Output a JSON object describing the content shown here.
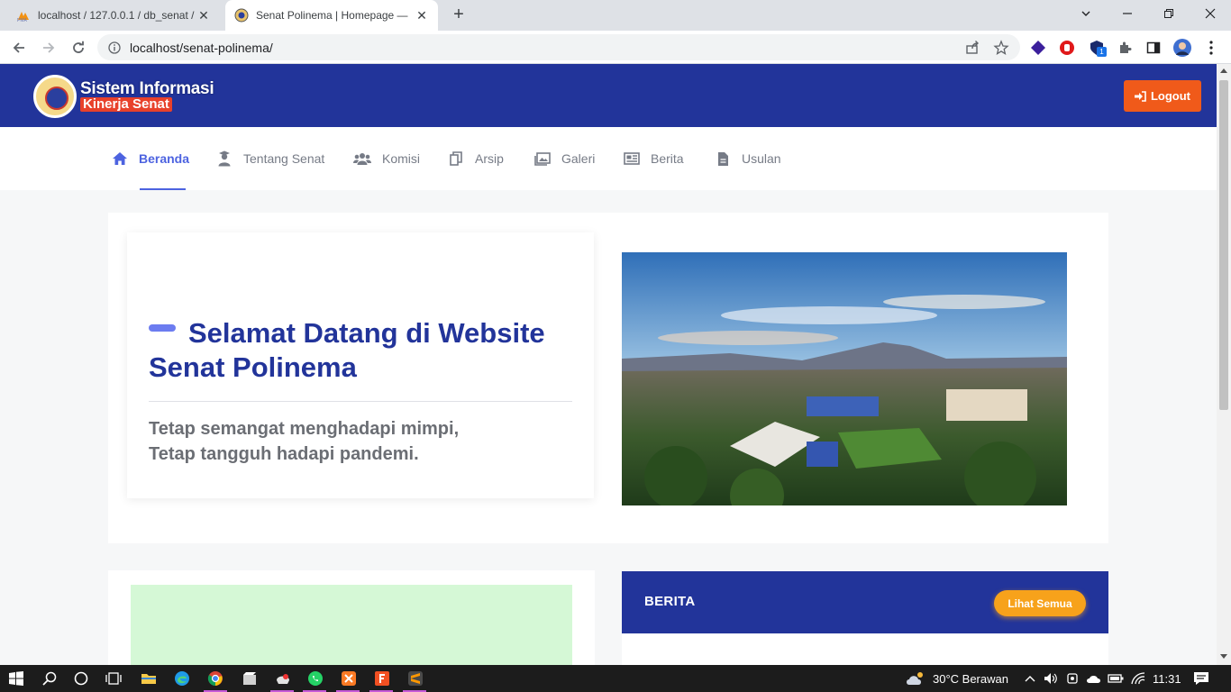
{
  "browser": {
    "tabs": [
      {
        "title": "localhost / 127.0.0.1 / db_senat /",
        "active": false
      },
      {
        "title": "Senat Polinema | Homepage —",
        "active": true
      }
    ],
    "url": "localhost/senat-polinema/",
    "extension_badge": "1"
  },
  "header": {
    "logo_line1": "Sistem Informasi",
    "logo_line2": "Kinerja Senat",
    "logout_label": "Logout"
  },
  "menu": {
    "items": [
      {
        "label": "Beranda",
        "icon": "home-icon",
        "active": true
      },
      {
        "label": "Tentang Senat",
        "icon": "graduate-icon"
      },
      {
        "label": "Komisi",
        "icon": "users-icon"
      },
      {
        "label": "Arsip",
        "icon": "copy-icon"
      },
      {
        "label": "Galeri",
        "icon": "gallery-icon"
      },
      {
        "label": "Berita",
        "icon": "newspaper-icon"
      },
      {
        "label": "Usulan",
        "icon": "file-icon"
      }
    ]
  },
  "hero": {
    "title": "Selamat Datang di Website Senat Polinema",
    "subtitle_line1": "Tetap semangat menghadapi mimpi,",
    "subtitle_line2": "Tetap tangguh hadapi pandemi."
  },
  "news": {
    "heading": "BERITA",
    "see_all_label": "Lihat Semua"
  },
  "taskbar": {
    "weather": "30°C  Berawan",
    "time": "11:31"
  },
  "colors": {
    "primary_navy": "#22349a",
    "logout_orange": "#f05a1a",
    "accent_blue": "#4d63e0",
    "lihat_amber": "#f7a21b",
    "placeholder_green": "#d5f8d6"
  }
}
